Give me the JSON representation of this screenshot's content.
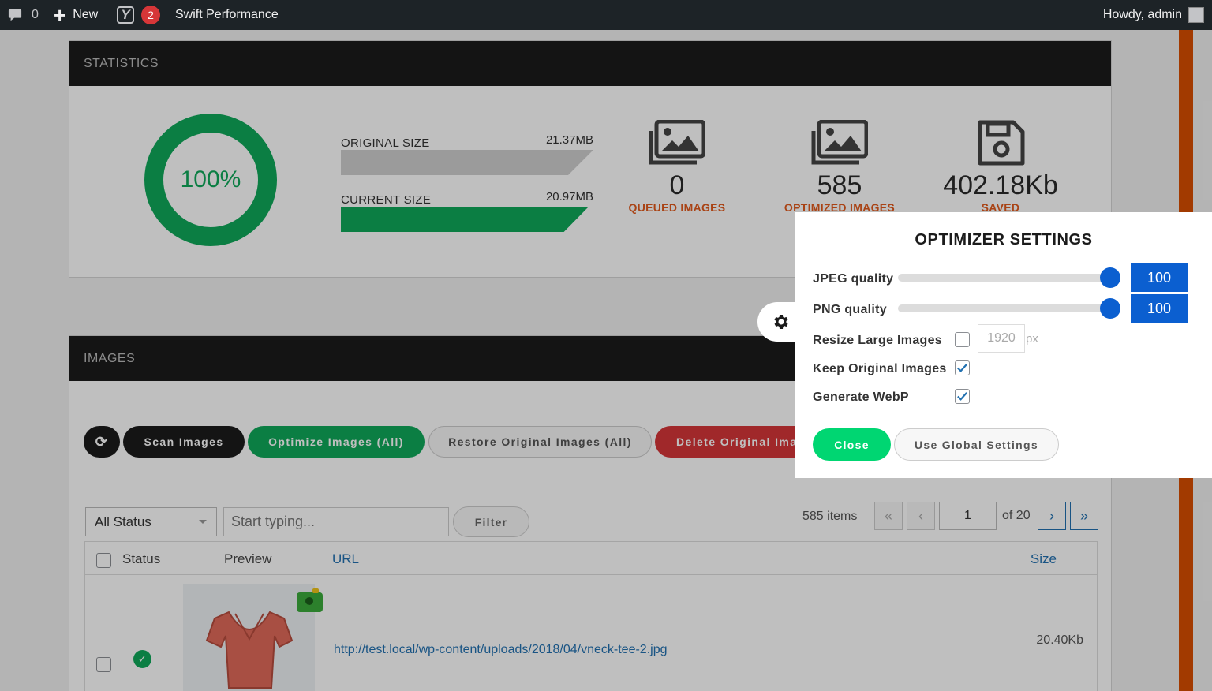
{
  "adminbar": {
    "comments_count": "0",
    "new_label": "New",
    "yoast_badge": "2",
    "plugin_label": "Swift Performance",
    "howdy": "Howdy, admin"
  },
  "statistics": {
    "header": "STATISTICS",
    "percent": "100%",
    "original_label": "ORIGINAL SIZE",
    "original_value": "21.37MB",
    "current_label": "CURRENT SIZE",
    "current_value": "20.97MB",
    "queued_count": "0",
    "queued_label": "QUEUED IMAGES",
    "optimized_count": "585",
    "optimized_label": "OPTIMIZED IMAGES",
    "saved_value": "402.18Kb",
    "saved_label": "SAVED"
  },
  "images": {
    "header": "IMAGES",
    "scan_label": "Scan Images",
    "optimize_label": "Optimize Images (All)",
    "restore_label": "Restore Original Images (All)",
    "delete_label": "Delete Original Images (All)",
    "status_select": "All Status",
    "search_placeholder": "Start typing...",
    "filter_label": "Filter",
    "items_count": "585 items",
    "first_page": "«",
    "prev_page": "‹",
    "current_page": "1",
    "of_pages": "of 20",
    "next_page": "›",
    "last_page": "»",
    "columns": {
      "status": "Status",
      "preview": "Preview",
      "url": "URL",
      "size": "Size"
    },
    "rows": [
      {
        "url": "http://test.local/wp-content/uploads/2018/04/vneck-tee-2.jpg",
        "size": "20.40Kb",
        "status_icon": "✓"
      }
    ]
  },
  "optimizer": {
    "title": "OPTIMIZER SETTINGS",
    "jpeg_label": "JPEG quality",
    "jpeg_value": "100",
    "png_label": "PNG quality",
    "png_value": "100",
    "resize_label": "Resize Large Images",
    "resize_checked": false,
    "resize_width": "1920",
    "resize_unit": "px",
    "keep_label": "Keep Original Images",
    "keep_checked": true,
    "webp_label": "Generate WebP",
    "webp_checked": true,
    "close_label": "Close",
    "global_label": "Use Global Settings"
  },
  "colors": {
    "green": "#0fa85a",
    "accent_blue": "#0b5fd0",
    "orange": "#e25a1c",
    "red": "#d63638"
  },
  "icons": {
    "comment": "speech-bubble-icon",
    "gear": "gear-icon",
    "image": "image-stack-icon",
    "save": "floppy-disk-icon"
  }
}
